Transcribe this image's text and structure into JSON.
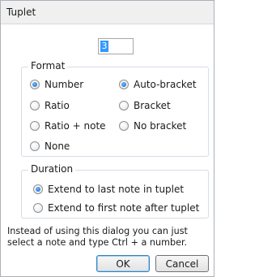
{
  "dialog": {
    "title": "Tuplet"
  },
  "number_field": {
    "value": "3"
  },
  "format": {
    "label": "Format",
    "options": [
      {
        "label": "Number",
        "selected": true
      },
      {
        "label": "Auto-bracket",
        "selected": true
      },
      {
        "label": "Ratio",
        "selected": false
      },
      {
        "label": "Bracket",
        "selected": false
      },
      {
        "label": "Ratio + note",
        "selected": false
      },
      {
        "label": "No bracket",
        "selected": false
      },
      {
        "label": "None",
        "selected": false
      }
    ]
  },
  "duration": {
    "label": "Duration",
    "options": [
      {
        "label": "Extend to last note in tuplet",
        "selected": true
      },
      {
        "label": "Extend to first note after tuplet",
        "selected": false
      }
    ]
  },
  "message": "Instead of using this dialog you can just select a note and type Ctrl + a number.",
  "buttons": {
    "ok": "OK",
    "cancel": "Cancel"
  }
}
